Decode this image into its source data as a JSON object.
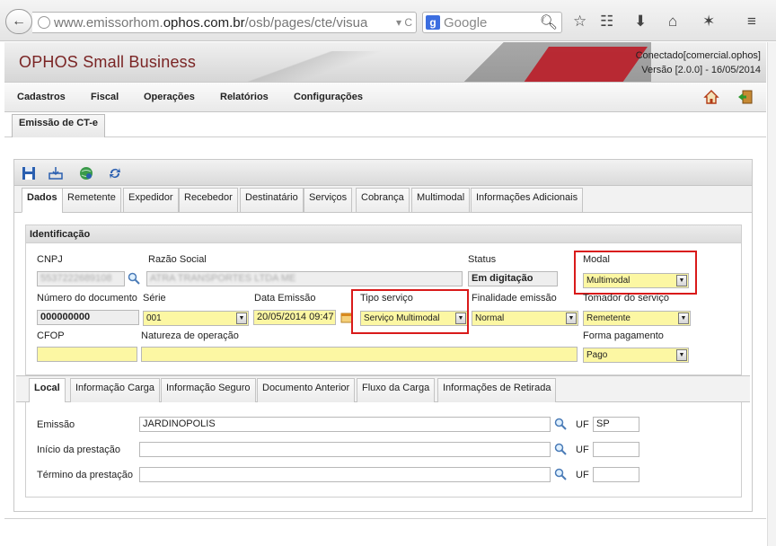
{
  "browser": {
    "url_scheme_host_prefix": "www.emissorhom.",
    "url_host": "ophos.com.br",
    "url_path": "/osb/pages/cte/visua",
    "url_tail": "▾ C",
    "search_engine": "Google"
  },
  "app": {
    "title": "OPHOS Small Business",
    "connected": "Conectado[comercial.ophos]",
    "version": "Versão [2.0.0] - 16/05/2014",
    "brand_color": "#7a2424"
  },
  "menu": {
    "items": [
      "Cadastros",
      "Fiscal",
      "Operações",
      "Relatórios",
      "Configurações"
    ]
  },
  "page_tab": "Emissão de CT-e",
  "tabs": [
    "Dados",
    "Remetente",
    "Expedidor",
    "Recebedor",
    "Destinatário",
    "Serviços",
    "Cobrança",
    "Multimodal",
    "Informações Adicionais"
  ],
  "identificacao": {
    "title": "Identificação",
    "cnpj_label": "CNPJ",
    "cnpj_value": "5537222689108",
    "razao_label": "Razão Social",
    "razao_value": "ATRA TRANSPORTES LTDA ME",
    "status_label": "Status",
    "status_value": "Em digitação",
    "modal_label": "Modal",
    "modal_value": "Multimodal",
    "numero_label": "Número do documento",
    "numero_value": "000000000",
    "serie_label": "Série",
    "serie_value": "001",
    "data_label": "Data Emissão",
    "data_value": "20/05/2014 09:47",
    "tipo_label": "Tipo serviço",
    "tipo_value": "Serviço Multimodal",
    "finalidade_label": "Finalidade emissão",
    "finalidade_value": "Normal",
    "tomador_label": "Tomador do serviço",
    "tomador_value": "Remetente",
    "cfop_label": "CFOP",
    "cfop_value": "",
    "natureza_label": "Natureza de operação",
    "natureza_value": "",
    "forma_label": "Forma pagamento",
    "forma_value": "Pago",
    "highlight_color": "#d91a1a"
  },
  "subtabs": [
    "Local",
    "Informação Carga",
    "Informação Seguro",
    "Documento Anterior",
    "Fluxo da Carga",
    "Informações de Retirada"
  ],
  "local": {
    "emissao_label": "Emissão",
    "emissao_value": "JARDINOPOLIS",
    "emissao_uf": "SP",
    "inicio_label": "Início da prestação",
    "inicio_value": "",
    "inicio_uf": "",
    "termino_label": "Término da prestação",
    "termino_value": "",
    "termino_uf": "",
    "uf_label": "UF"
  }
}
